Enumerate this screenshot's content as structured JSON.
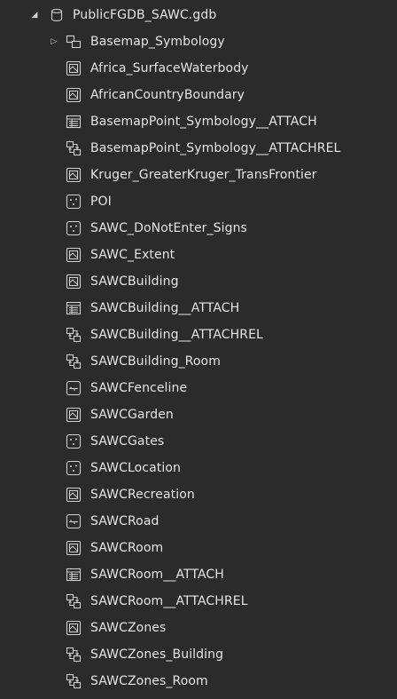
{
  "root": {
    "label": "PublicFGDB_SAWC.gdb",
    "expanded": true,
    "icon": "database-icon"
  },
  "items": [
    {
      "label": "Basemap_Symbology",
      "icon": "dataset-icon",
      "expandable": true
    },
    {
      "label": "Africa_SurfaceWaterbody",
      "icon": "polygon-featureclass-icon"
    },
    {
      "label": "AfricanCountryBoundary",
      "icon": "polygon-featureclass-icon"
    },
    {
      "label": "BasemapPoint_Symbology__ATTACH",
      "icon": "table-icon"
    },
    {
      "label": "BasemapPoint_Symbology__ATTACHREL",
      "icon": "relationship-class-icon"
    },
    {
      "label": "Kruger_GreaterKruger_TransFrontier",
      "icon": "polygon-featureclass-icon"
    },
    {
      "label": "POI",
      "icon": "point-featureclass-icon"
    },
    {
      "label": "SAWC_DoNotEnter_Signs",
      "icon": "point-featureclass-icon"
    },
    {
      "label": "SAWC_Extent",
      "icon": "polygon-featureclass-icon"
    },
    {
      "label": "SAWCBuilding",
      "icon": "polygon-featureclass-icon"
    },
    {
      "label": "SAWCBuilding__ATTACH",
      "icon": "table-icon"
    },
    {
      "label": "SAWCBuilding__ATTACHREL",
      "icon": "relationship-class-icon"
    },
    {
      "label": "SAWCBuilding_Room",
      "icon": "relationship-class-icon"
    },
    {
      "label": "SAWCFenceline",
      "icon": "line-featureclass-icon"
    },
    {
      "label": "SAWCGarden",
      "icon": "polygon-featureclass-icon"
    },
    {
      "label": "SAWCGates",
      "icon": "point-featureclass-icon"
    },
    {
      "label": "SAWCLocation",
      "icon": "point-featureclass-icon"
    },
    {
      "label": "SAWCRecreation",
      "icon": "polygon-featureclass-icon"
    },
    {
      "label": "SAWCRoad",
      "icon": "line-featureclass-icon"
    },
    {
      "label": "SAWCRoom",
      "icon": "polygon-featureclass-icon"
    },
    {
      "label": "SAWCRoom__ATTACH",
      "icon": "table-icon"
    },
    {
      "label": "SAWCRoom__ATTACHREL",
      "icon": "relationship-class-icon"
    },
    {
      "label": "SAWCZones",
      "icon": "polygon-featureclass-icon"
    },
    {
      "label": "SAWCZones_Building",
      "icon": "relationship-class-icon"
    },
    {
      "label": "SAWCZones_Room",
      "icon": "relationship-class-icon"
    }
  ],
  "colors": {
    "background": "#2b2b2b",
    "text": "#e6e6e6",
    "icon": "#cfcfcf"
  }
}
